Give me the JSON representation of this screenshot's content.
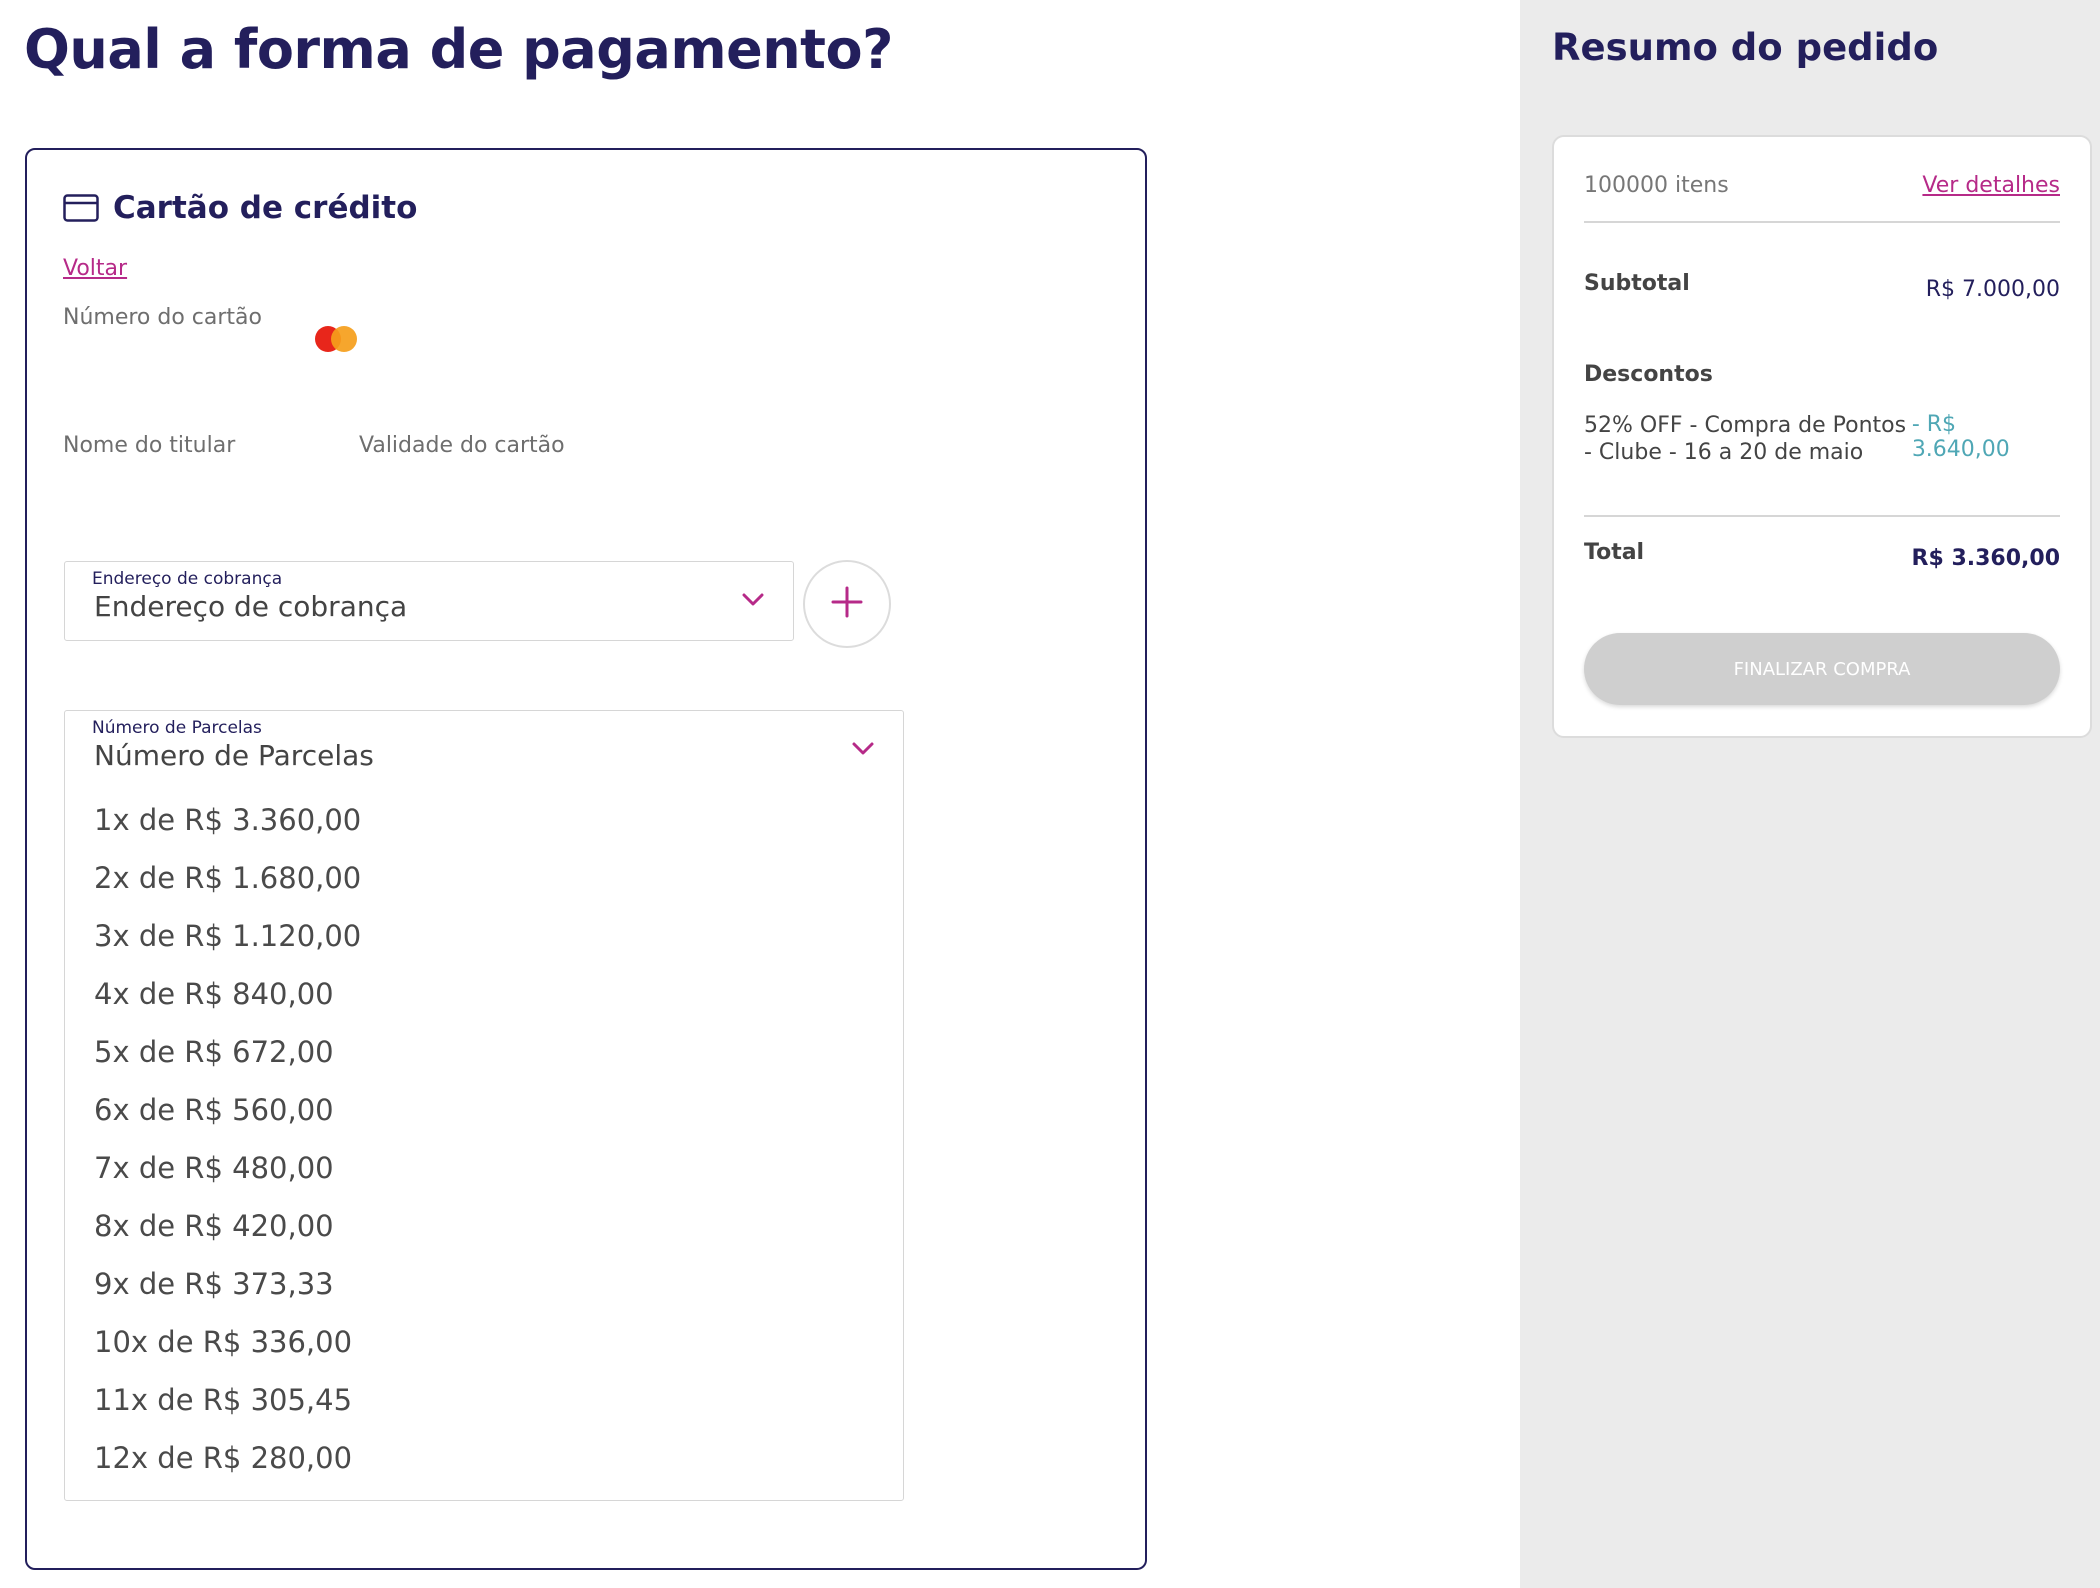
{
  "page": {
    "title": "Qual a forma de pagamento?"
  },
  "payment": {
    "method_title": "Cartão de crédito",
    "method_icon": "credit-card-icon",
    "back_label": "Voltar",
    "card_number_label": "Número do cartão",
    "card_brand_icon": "mastercard-logo",
    "holder_label": "Nome do titular",
    "expiry_label": "Validade do cartão",
    "billing_address": {
      "label": "Endereço de cobrança",
      "value": "Endereço de cobrança"
    },
    "installments": {
      "label": "Número de Parcelas",
      "value": "Número de Parcelas",
      "options": [
        "1x de R$ 3.360,00",
        "2x de R$ 1.680,00",
        "3x de R$ 1.120,00",
        "4x de R$ 840,00",
        "5x de R$ 672,00",
        "6x de R$ 560,00",
        "7x de R$ 480,00",
        "8x de R$ 420,00",
        "9x de R$ 373,33",
        "10x de R$ 336,00",
        "11x de R$ 305,45",
        "12x de R$ 280,00"
      ]
    }
  },
  "summary": {
    "title": "Resumo do pedido",
    "items_count": "100000 itens",
    "details_link": "Ver detalhes",
    "subtotal_label": "Subtotal",
    "subtotal_value": "R$ 7.000,00",
    "discounts_label": "Descontos",
    "discount_text": "52% OFF - Compra de Pontos - Clube - 16 a 20 de maio",
    "discount_value": "- R$ 3.640,00",
    "total_label": "Total",
    "total_value": "R$ 3.360,00",
    "finish_button": "FINALIZAR COMPRA"
  },
  "colors": {
    "primary": "#231f5c",
    "accent": "#b62a88",
    "discount": "#4fa7b5",
    "sidebar_bg": "#ebebeb",
    "disabled_button": "#cfcfcf"
  }
}
